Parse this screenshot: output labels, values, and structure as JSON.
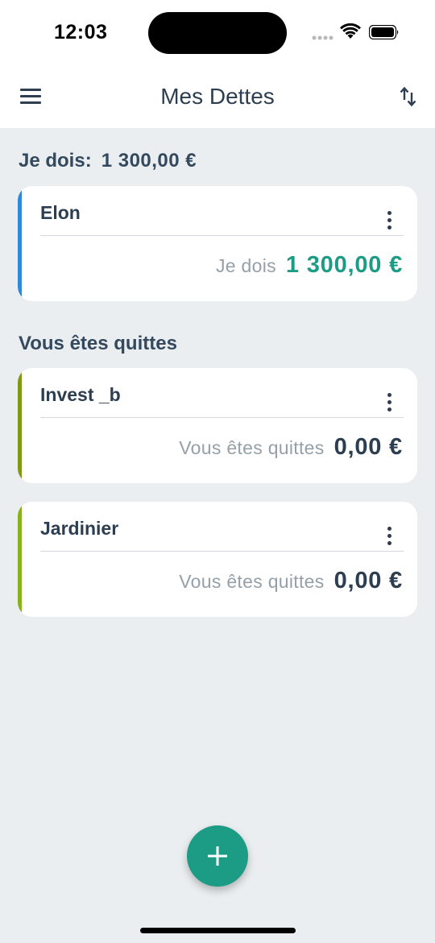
{
  "status_bar": {
    "time": "12:03",
    "icons": [
      "signal-dots-icon",
      "wifi-icon",
      "battery-icon"
    ]
  },
  "app_bar": {
    "title": "Mes Dettes",
    "left_icon": "menu-icon",
    "right_icon": "sort-icon"
  },
  "summary": {
    "label": "Je dois:",
    "amount": "1 300,00 €"
  },
  "settled_section": {
    "title": "Vous êtes quittes"
  },
  "cards": [
    {
      "name": "Elon",
      "status": "Je dois",
      "amount": "1 300,00 €",
      "accent_color": "#2e8ad8",
      "amount_color": "#1d9c85"
    },
    {
      "name": "Invest _b",
      "status": "Vous êtes quittes",
      "amount": "0,00 €",
      "accent_color": "#7f9a12",
      "amount_color": "#2c3e50"
    },
    {
      "name": "Jardinier",
      "status": "Vous êtes quittes",
      "amount": "0,00 €",
      "accent_color": "#86b21a",
      "amount_color": "#2c3e50"
    }
  ],
  "fab": {
    "icon": "plus-icon",
    "color": "#1d9c85"
  }
}
